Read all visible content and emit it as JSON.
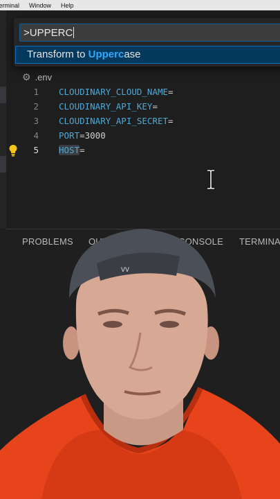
{
  "menubar": {
    "items": [
      "Terminal",
      "Window",
      "Help"
    ]
  },
  "command_palette": {
    "input_value": ">UPPERC",
    "result": {
      "prefix": "Transform to ",
      "match": "Upperc",
      "suffix": "ase"
    }
  },
  "breadcrumb": {
    "file": ".env",
    "icon": "gear-icon"
  },
  "editor": {
    "lines": [
      {
        "num": "1",
        "key": "CLOUDINARY_CLOUD_NAME",
        "rest": "="
      },
      {
        "num": "2",
        "key": "CLOUDINARY_API_KEY",
        "rest": "="
      },
      {
        "num": "3",
        "key": "CLOUDINARY_API_SECRET",
        "rest": "="
      },
      {
        "num": "4",
        "key": "PORT",
        "rest": "=3000"
      },
      {
        "num": "5",
        "key": "HOST",
        "rest": "="
      }
    ],
    "active_line": "5"
  },
  "panel": {
    "tabs": [
      "PROBLEMS",
      "OUT",
      "CONSOLE",
      "TERMINAL"
    ]
  },
  "colors": {
    "accent": "#0b6fbe",
    "match": "#2aaaff",
    "env_key": "#4fa8d6",
    "hoodie": "#e8441c"
  }
}
